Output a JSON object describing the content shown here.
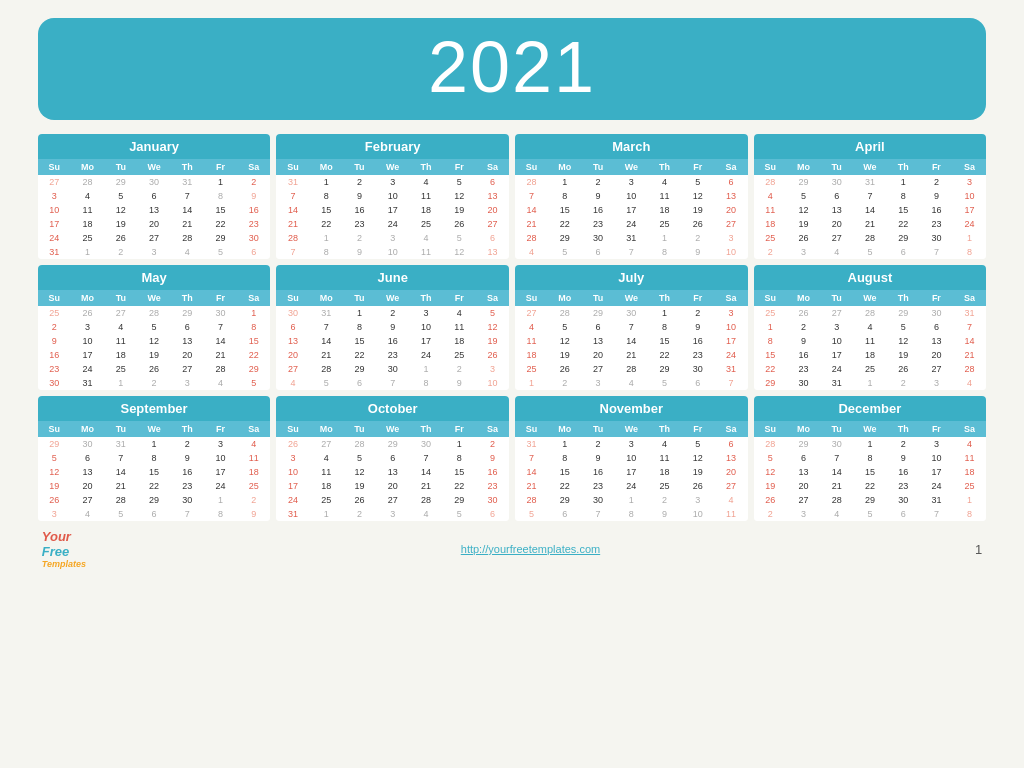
{
  "year": "2021",
  "months": [
    {
      "name": "January",
      "weeks": [
        [
          "27",
          "28",
          "29",
          "30",
          "31",
          "1",
          "2"
        ],
        [
          "3",
          "4",
          "5",
          "6",
          "7",
          "8",
          "9"
        ],
        [
          "10",
          "11",
          "12",
          "13",
          "14",
          "15",
          "16"
        ],
        [
          "17",
          "18",
          "19",
          "20",
          "21",
          "22",
          "23"
        ],
        [
          "24",
          "25",
          "26",
          "27",
          "28",
          "29",
          "30"
        ],
        [
          "31",
          "1",
          "2",
          "3",
          "4",
          "5",
          "6"
        ]
      ],
      "others": [
        [
          0,
          1,
          2,
          3,
          4
        ],
        [
          5,
          6
        ],
        [],
        [],
        [],
        [
          1,
          2,
          3,
          4,
          5,
          6
        ]
      ]
    },
    {
      "name": "February",
      "weeks": [
        [
          "31",
          "1",
          "2",
          "3",
          "4",
          "5",
          "6"
        ],
        [
          "7",
          "8",
          "9",
          "10",
          "11",
          "12",
          "13"
        ],
        [
          "14",
          "15",
          "16",
          "17",
          "18",
          "19",
          "20"
        ],
        [
          "21",
          "22",
          "23",
          "24",
          "25",
          "26",
          "27"
        ],
        [
          "28",
          "1",
          "2",
          "3",
          "4",
          "5",
          "6"
        ],
        [
          "7",
          "8",
          "9",
          "10",
          "11",
          "12",
          "13"
        ]
      ],
      "others": [
        [
          0
        ],
        [],
        [],
        [],
        [
          1,
          2,
          3,
          4,
          5,
          6
        ],
        [
          0,
          1,
          2,
          3,
          4,
          5,
          6
        ]
      ]
    },
    {
      "name": "March",
      "weeks": [
        [
          "28",
          "1",
          "2",
          "3",
          "4",
          "5",
          "6"
        ],
        [
          "7",
          "8",
          "9",
          "10",
          "11",
          "12",
          "13"
        ],
        [
          "14",
          "15",
          "16",
          "17",
          "18",
          "19",
          "20"
        ],
        [
          "21",
          "22",
          "23",
          "24",
          "25",
          "26",
          "27"
        ],
        [
          "28",
          "29",
          "30",
          "31",
          "1",
          "2",
          "3"
        ],
        [
          "4",
          "5",
          "6",
          "7",
          "8",
          "9",
          "10"
        ]
      ],
      "others": [
        [
          0
        ],
        [],
        [],
        [],
        [
          4,
          5,
          6
        ],
        [
          0,
          1,
          2,
          3,
          4,
          5,
          6
        ]
      ]
    },
    {
      "name": "April",
      "weeks": [
        [
          "28",
          "29",
          "30",
          "31",
          "1",
          "2",
          "3"
        ],
        [
          "4",
          "5",
          "6",
          "7",
          "8",
          "9",
          "10"
        ],
        [
          "11",
          "12",
          "13",
          "14",
          "15",
          "16",
          "17"
        ],
        [
          "18",
          "19",
          "20",
          "21",
          "22",
          "23",
          "24"
        ],
        [
          "25",
          "26",
          "27",
          "28",
          "29",
          "30",
          "1"
        ],
        [
          "2",
          "3",
          "4",
          "5",
          "6",
          "7",
          "8"
        ]
      ],
      "others": [
        [
          0,
          1,
          2,
          3
        ],
        [],
        [],
        [],
        [
          6
        ],
        [
          0,
          1,
          2,
          3,
          4,
          5,
          6
        ]
      ]
    },
    {
      "name": "May",
      "weeks": [
        [
          "25",
          "26",
          "27",
          "28",
          "29",
          "30",
          "1"
        ],
        [
          "2",
          "3",
          "4",
          "5",
          "6",
          "7",
          "8"
        ],
        [
          "9",
          "10",
          "11",
          "12",
          "13",
          "14",
          "15"
        ],
        [
          "16",
          "17",
          "18",
          "19",
          "20",
          "21",
          "22"
        ],
        [
          "23",
          "24",
          "25",
          "26",
          "27",
          "28",
          "29"
        ],
        [
          "30",
          "31",
          "1",
          "2",
          "3",
          "4",
          "5"
        ]
      ],
      "others": [
        [
          0,
          1,
          2,
          3,
          4,
          5
        ],
        [],
        [],
        [],
        [],
        [
          2,
          3,
          4,
          5
        ]
      ]
    },
    {
      "name": "June",
      "weeks": [
        [
          "30",
          "31",
          "1",
          "2",
          "3",
          "4",
          "5"
        ],
        [
          "6",
          "7",
          "8",
          "9",
          "10",
          "11",
          "12"
        ],
        [
          "13",
          "14",
          "15",
          "16",
          "17",
          "18",
          "19"
        ],
        [
          "20",
          "21",
          "22",
          "23",
          "24",
          "25",
          "26"
        ],
        [
          "27",
          "28",
          "29",
          "30",
          "1",
          "2",
          "3"
        ],
        [
          "4",
          "5",
          "6",
          "7",
          "8",
          "9",
          "10"
        ]
      ],
      "others": [
        [
          0,
          1
        ],
        [],
        [],
        [],
        [
          4,
          5,
          6
        ],
        [
          0,
          1,
          2,
          3,
          4,
          5,
          6
        ]
      ]
    },
    {
      "name": "July",
      "weeks": [
        [
          "27",
          "28",
          "29",
          "30",
          "1",
          "2",
          "3"
        ],
        [
          "4",
          "5",
          "6",
          "7",
          "8",
          "9",
          "10"
        ],
        [
          "11",
          "12",
          "13",
          "14",
          "15",
          "16",
          "17"
        ],
        [
          "18",
          "19",
          "20",
          "21",
          "22",
          "23",
          "24"
        ],
        [
          "25",
          "26",
          "27",
          "28",
          "29",
          "30",
          "31"
        ],
        [
          "1",
          "2",
          "3",
          "4",
          "5",
          "6",
          "7"
        ]
      ],
      "others": [
        [
          0,
          1,
          2,
          3
        ],
        [],
        [],
        [],
        [],
        [
          0,
          1,
          2,
          3,
          4,
          5,
          6
        ]
      ]
    },
    {
      "name": "August",
      "weeks": [
        [
          "25",
          "26",
          "27",
          "28",
          "29",
          "30",
          "31"
        ],
        [
          "1",
          "2",
          "3",
          "4",
          "5",
          "6",
          "7"
        ],
        [
          "8",
          "9",
          "10",
          "11",
          "12",
          "13",
          "14"
        ],
        [
          "15",
          "16",
          "17",
          "18",
          "19",
          "20",
          "21"
        ],
        [
          "22",
          "23",
          "24",
          "25",
          "26",
          "27",
          "28"
        ],
        [
          "29",
          "30",
          "31",
          "1",
          "2",
          "3",
          "4"
        ]
      ],
      "others": [
        [
          0,
          1,
          2,
          3,
          4,
          5,
          6
        ],
        [],
        [],
        [],
        [],
        [
          3,
          4,
          5,
          6
        ]
      ]
    },
    {
      "name": "September",
      "weeks": [
        [
          "29",
          "30",
          "31",
          "1",
          "2",
          "3",
          "4"
        ],
        [
          "5",
          "6",
          "7",
          "8",
          "9",
          "10",
          "11"
        ],
        [
          "12",
          "13",
          "14",
          "15",
          "16",
          "17",
          "18"
        ],
        [
          "19",
          "20",
          "21",
          "22",
          "23",
          "24",
          "25"
        ],
        [
          "26",
          "27",
          "28",
          "29",
          "30",
          "1",
          "2"
        ],
        [
          "3",
          "4",
          "5",
          "6",
          "7",
          "8",
          "9"
        ]
      ],
      "others": [
        [
          0,
          1,
          2
        ],
        [],
        [],
        [],
        [
          5,
          6
        ],
        [
          0,
          1,
          2,
          3,
          4,
          5,
          6
        ]
      ]
    },
    {
      "name": "October",
      "weeks": [
        [
          "26",
          "27",
          "28",
          "29",
          "30",
          "1",
          "2"
        ],
        [
          "3",
          "4",
          "5",
          "6",
          "7",
          "8",
          "9"
        ],
        [
          "10",
          "11",
          "12",
          "13",
          "14",
          "15",
          "16"
        ],
        [
          "17",
          "18",
          "19",
          "20",
          "21",
          "22",
          "23"
        ],
        [
          "24",
          "25",
          "26",
          "27",
          "28",
          "29",
          "30"
        ],
        [
          "31",
          "1",
          "2",
          "3",
          "4",
          "5",
          "6"
        ]
      ],
      "others": [
        [
          0,
          1,
          2,
          3,
          4
        ],
        [],
        [],
        [],
        [],
        [
          1,
          2,
          3,
          4,
          5,
          6
        ]
      ]
    },
    {
      "name": "November",
      "weeks": [
        [
          "31",
          "1",
          "2",
          "3",
          "4",
          "5",
          "6"
        ],
        [
          "7",
          "8",
          "9",
          "10",
          "11",
          "12",
          "13"
        ],
        [
          "14",
          "15",
          "16",
          "17",
          "18",
          "19",
          "20"
        ],
        [
          "21",
          "22",
          "23",
          "24",
          "25",
          "26",
          "27"
        ],
        [
          "28",
          "29",
          "30",
          "1",
          "2",
          "3",
          "4"
        ],
        [
          "5",
          "6",
          "7",
          "8",
          "9",
          "10",
          "11"
        ]
      ],
      "others": [
        [
          0
        ],
        [],
        [],
        [],
        [
          3,
          4,
          5,
          6
        ],
        [
          0,
          1,
          2,
          3,
          4,
          5,
          6
        ]
      ]
    },
    {
      "name": "December",
      "weeks": [
        [
          "28",
          "29",
          "30",
          "1",
          "2",
          "3",
          "4"
        ],
        [
          "5",
          "6",
          "7",
          "8",
          "9",
          "10",
          "11"
        ],
        [
          "12",
          "13",
          "14",
          "15",
          "16",
          "17",
          "18"
        ],
        [
          "19",
          "20",
          "21",
          "22",
          "23",
          "24",
          "25"
        ],
        [
          "26",
          "27",
          "28",
          "29",
          "30",
          "31",
          "1"
        ],
        [
          "2",
          "3",
          "4",
          "5",
          "6",
          "7",
          "8"
        ]
      ],
      "others": [
        [
          0,
          1,
          2
        ],
        [],
        [],
        [],
        [
          6
        ],
        [
          0,
          1,
          2,
          3,
          4,
          5,
          6
        ]
      ]
    }
  ],
  "dayHeaders": [
    "Su",
    "Mo",
    "Tu",
    "We",
    "Th",
    "Fr",
    "Sa"
  ],
  "footer": {
    "logo": {
      "your": "Your",
      "free": "Free",
      "templates": "Templates"
    },
    "url": "http://yourfreetemplates.com",
    "page": "1"
  }
}
